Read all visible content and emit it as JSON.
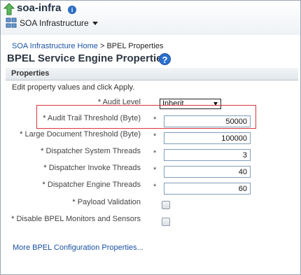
{
  "header": {
    "title": "soa-infra",
    "menu_label": "SOA Infrastructure"
  },
  "breadcrumb": {
    "home": "SOA Infrastructure Home",
    "separator": ">",
    "current": "BPEL Properties"
  },
  "page": {
    "title": "BPEL Service Engine Properties",
    "section_title": "Properties",
    "instruction": "Edit property values and click Apply."
  },
  "fields": {
    "audit_level": {
      "label": "Audit Level",
      "value": "Inherit"
    },
    "audit_trail_threshold": {
      "label": "Audit Trail Threshold (Byte)",
      "value": "50000"
    },
    "large_document_threshold": {
      "label": "Large Document Threshold (Byte)",
      "value": "100000"
    },
    "dispatcher_system_threads": {
      "label": "Dispatcher System Threads",
      "value": "3"
    },
    "dispatcher_invoke_threads": {
      "label": "Dispatcher Invoke Threads",
      "value": "40"
    },
    "dispatcher_engine_threads": {
      "label": "Dispatcher Engine Threads",
      "value": "60"
    },
    "payload_validation": {
      "label": "Payload Validation",
      "checked": false
    },
    "disable_bpel_monitors": {
      "label": "Disable BPEL Monitors and Sensors",
      "checked": false
    }
  },
  "required_marker": "*",
  "more_link": "More BPEL Configuration Properties...",
  "icons": {
    "up": "up-arrow-icon",
    "info": "info-icon",
    "menu": "soa-infrastructure-icon",
    "help": "help-icon"
  },
  "colors": {
    "link": "#1a52a3",
    "highlight": "#d9363e",
    "help": "#2b6fd0"
  }
}
